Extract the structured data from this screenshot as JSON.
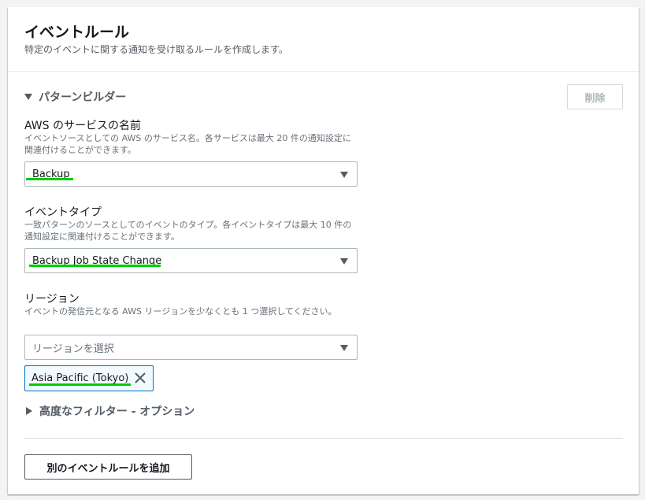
{
  "header": {
    "title": "イベントルール",
    "description": "特定のイベントに関する通知を受け取るルールを作成します。"
  },
  "pattern_builder": {
    "label": "パターンビルダー",
    "expanded": true,
    "delete_label": "削除",
    "delete_enabled": false
  },
  "service_name": {
    "label": "AWS のサービスの名前",
    "description": "イベントソースとしての AWS のサービス名。各サービスは最大 20 件の通知設定に関連付けることができます。",
    "value": "Backup"
  },
  "event_type": {
    "label": "イベントタイプ",
    "description": "一致パターンのソースとしてのイベントのタイプ。各イベントタイプは最大 10 件の通知設定に関連付けることができます。",
    "value": "Backup Job State Change"
  },
  "region": {
    "label": "リージョン",
    "description": "イベントの発信元となる AWS リージョンを少なくとも 1 つ選択してください。",
    "placeholder": "リージョンを選択",
    "selected_tokens": [
      "Asia Pacific (Tokyo)"
    ]
  },
  "advanced_filter": {
    "label": "高度なフィルター - オプション",
    "expanded": false
  },
  "add_rule_label": "別のイベントルールを追加",
  "colors": {
    "highlight_underline": "#00cc00",
    "token_border": "#0073bb",
    "token_background": "#f1faff"
  },
  "icons": {
    "expanded_caret": "caret-down-icon",
    "collapsed_caret": "caret-right-icon",
    "dropdown": "chevron-down-icon",
    "token_remove": "close-icon"
  }
}
